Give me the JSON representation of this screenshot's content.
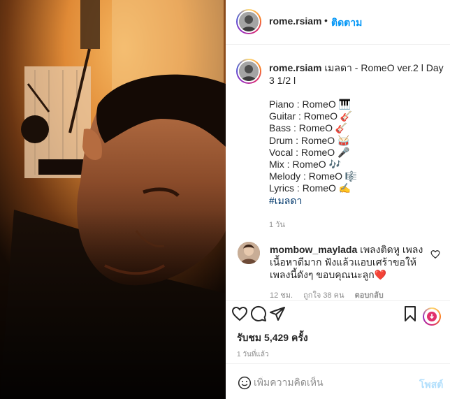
{
  "post": {
    "author": "rome.rsiam",
    "follow_separator": "•",
    "follow_label": "ติดตาม",
    "caption": {
      "username": "rome.rsiam",
      "text": "เมลดา - RomeO ver.2 l Day 3 1/2 l",
      "lines": [
        "Piano : RomeO 🎹",
        "Guitar : RomeO 🎸",
        "Bass : RomeO 🎸",
        "Drum : RomeO 🥁",
        "Vocal : RomeO 🎤",
        "Mix : RomeO 🎶",
        "Melody : RomeO 🎼",
        "Lyrics : RomeO ✍️"
      ],
      "hashtag": "#เมลดา",
      "time": "1 วัน"
    },
    "comment": {
      "username": "mombow_maylada",
      "text": "เพลงติดหู เพลงเนื้อหาดีมาก ฟังแล้วแอบเศร้าขอให้เพลงนี้ดังๆ ขอบคุณนะลูก❤️",
      "time": "12 ชม.",
      "likes": "ถูกใจ 38 คน",
      "reply_label": "ตอบกลับ"
    },
    "views": "รับชม 5,429 ครั้ง",
    "posted_ago": "1 วันที่แล้ว",
    "add_comment": {
      "placeholder": "เพิ่มความคิดเห็น",
      "post_label": "โพสต์"
    }
  },
  "icons": {
    "like": "heart-icon",
    "comment": "comment-bubble-icon",
    "share": "paper-plane-icon",
    "save": "bookmark-icon",
    "emoji": "smiley-icon",
    "download": "download-icon"
  },
  "colors": {
    "link": "#0095f6",
    "hashtag": "#00376b",
    "muted": "#8e8e8e",
    "post_disabled": "#b2dffc"
  }
}
